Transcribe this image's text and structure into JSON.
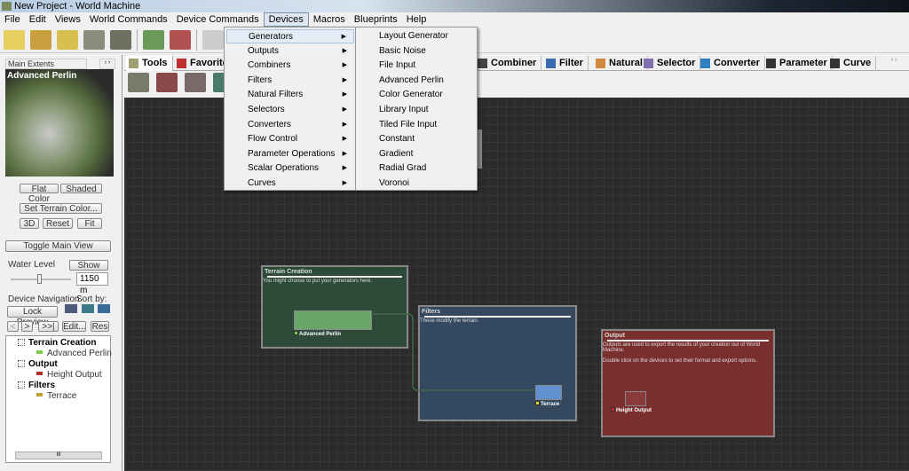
{
  "window": {
    "title": "New Project - World Machine"
  },
  "menubar": [
    "File",
    "Edit",
    "Views",
    "World Commands",
    "Device Commands",
    "Devices",
    "Macros",
    "Blueprints",
    "Help"
  ],
  "devices_menu": {
    "items": [
      "Generators",
      "Outputs",
      "Combiners",
      "Filters",
      "Natural Filters",
      "Selectors",
      "Converters",
      "Flow Control",
      "Parameter Operations",
      "Scalar Operations",
      "Curves"
    ],
    "generators_submenu": [
      "Layout Generator",
      "Basic Noise",
      "File Input",
      "Advanced Perlin",
      "Color Generator",
      "Library Input",
      "Tiled File Input",
      "Constant",
      "Gradient",
      "Radial Grad",
      "Voronoi"
    ]
  },
  "left_panel": {
    "extents_label": "Main Extents",
    "preview_title": "Advanced Perlin",
    "flat_color": "Flat Color",
    "shaded": "Shaded",
    "set_terrain_color": "Set Terrain Color...",
    "btn_3d": "3D",
    "reset": "Reset",
    "fit": "Fit",
    "toggle_main_view": "Toggle Main View",
    "water_level_label": "Water Level",
    "show": "Show",
    "water_level_value": "1150 m",
    "water_level_slider": 0.5,
    "device_navigation": "Device Navigation",
    "sort_by": "Sort by:",
    "lock_preview": "Lock Preview",
    "prev": "<",
    "next": ">",
    "last": ">>|",
    "edit": "Edit...",
    "res": "Res",
    "tree": [
      {
        "group": "Terrain Creation",
        "child": "Advanced Perlin",
        "color": "#7ad04a"
      },
      {
        "group": "Output",
        "child": "Height Output",
        "color": "#b03030"
      },
      {
        "group": "Filters",
        "child": "Terrace",
        "color": "#c0a030"
      }
    ],
    "scroll_label": "III"
  },
  "tabs": [
    "Tools",
    "Favorites",
    "Combiner",
    "Filter",
    "Natural",
    "Selector",
    "Converter",
    "Parameter",
    "Curve"
  ],
  "canvas": {
    "groups": [
      {
        "title": "Terrain Creation",
        "desc": "You might choose to put your generators here.",
        "node": "Advanced Perlin"
      },
      {
        "title": "Filters",
        "desc": "These modify the terrain.",
        "node": "Terrace"
      },
      {
        "title": "Output",
        "desc": "Outputs are used to export the results of your creation out of World Machine.",
        "desc2": "Double click on the devices to set their format and export options.",
        "node": "Height Output"
      }
    ]
  }
}
